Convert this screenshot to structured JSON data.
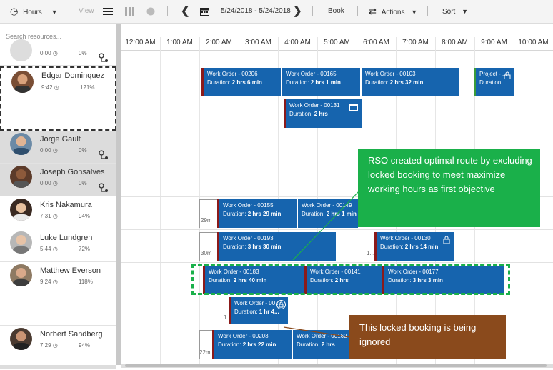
{
  "toolbar": {
    "hours_label": "Hours",
    "view_label": "View",
    "date_range": "5/24/2018 - 5/24/2018",
    "book_label": "Book",
    "actions_label": "Actions",
    "sort_label": "Sort"
  },
  "search": {
    "placeholder": "Search resources..."
  },
  "timeline": {
    "hours": [
      "12:00 AM",
      "1:00 AM",
      "2:00 AM",
      "3:00 AM",
      "4:00 AM",
      "5:00 AM",
      "6:00 AM",
      "7:00 AM",
      "8:00 AM",
      "9:00 AM",
      "10:00 AM"
    ]
  },
  "resources": [
    {
      "name": "",
      "time": "0:00",
      "pct": "0%"
    },
    {
      "name": "Edgar Dominquez",
      "time": "9:42",
      "pct": "121%"
    },
    {
      "name": "Jorge Gault",
      "time": "0:00",
      "pct": "0%"
    },
    {
      "name": "Joseph Gonsalves",
      "time": "0:00",
      "pct": "0%"
    },
    {
      "name": "Kris Nakamura",
      "time": "7:31",
      "pct": "94%"
    },
    {
      "name": "Luke Lundgren",
      "time": "5:44",
      "pct": "72%"
    },
    {
      "name": "Matthew Everson",
      "time": "9:24",
      "pct": "118%"
    },
    {
      "name": "Norbert Sandberg",
      "time": "7:29",
      "pct": "94%"
    }
  ],
  "bookings": [
    {
      "title": "Work Order - 00206",
      "dur_label": "Duration:",
      "dur": "2 hrs 6 min"
    },
    {
      "title": "Work Order - 00165",
      "dur_label": "Duration:",
      "dur": "2 hrs 1 min"
    },
    {
      "title": "Work Order - 00103",
      "dur_label": "Duration:",
      "dur": "2 hrs 32 min"
    },
    {
      "title": "Project - ...",
      "dur_label": "Duration...",
      "dur": ""
    },
    {
      "title": "Work Order - 00131",
      "dur_label": "Duration:",
      "dur": "2 hrs"
    },
    {
      "title": "Work Order - 00155",
      "dur_label": "Duration:",
      "dur": "2 hrs 29 min"
    },
    {
      "title": "Work Order - 00149",
      "dur_label": "Duration:",
      "dur": "2 hrs 1 min"
    },
    {
      "title": "Work Order - 00193",
      "dur_label": "Duration:",
      "dur": "3 hrs 30 min"
    },
    {
      "title": "Work Order - 00130",
      "dur_label": "Duration:",
      "dur": "2 hrs 14 min"
    },
    {
      "title": "Work Order - 00183",
      "dur_label": "Duration:",
      "dur": "2 hrs 40 min"
    },
    {
      "title": "Work Order - 00141",
      "dur_label": "Duration:",
      "dur": "2 hrs"
    },
    {
      "title": "Work Order - 00177",
      "dur_label": "Duration:",
      "dur": "3 hrs 3 min"
    },
    {
      "title": "Work Order - 00...",
      "dur_label": "Duration:",
      "dur": "1 hr 4..."
    },
    {
      "title": "Work Order - 00203",
      "dur_label": "Duration:",
      "dur": "2 hrs 22 min"
    },
    {
      "title": "Work Order - 00162",
      "dur_label": "Duration:",
      "dur": "2 hrs"
    }
  ],
  "travel": [
    "29m",
    "30m",
    "1...",
    "1...",
    "22m"
  ],
  "callouts": {
    "green": "RSO created optimal route by excluding locked booking to meet maximize working hours as first objective",
    "brown": "This locked booking is being ignored"
  },
  "colors": {
    "booking": "#1664ae",
    "callout_green": "#1ab04a",
    "callout_brown": "#8a4a1c",
    "selected_row_border": "#333333"
  }
}
